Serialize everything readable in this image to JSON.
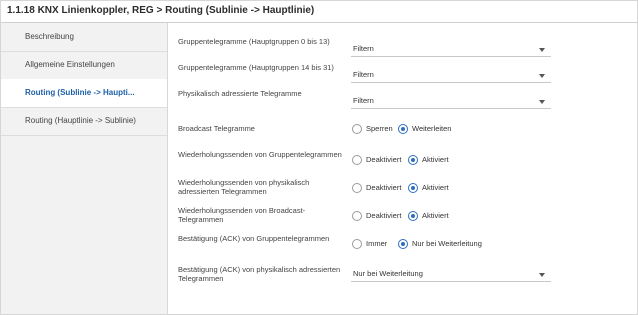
{
  "window": {
    "title": "1.1.18 KNX Linienkoppler, REG > Routing (Sublinie -> Hauptlinie)"
  },
  "sidebar": {
    "items": [
      {
        "label": "Beschreibung",
        "active": false
      },
      {
        "label": "Allgemeine Einstellungen",
        "active": false
      },
      {
        "label": "Routing (Sublinie -> Haupti...",
        "active": true
      },
      {
        "label": "Routing (Hauptlinie -> Sublinie)",
        "active": false
      }
    ]
  },
  "params": [
    {
      "label": "Gruppentelegramme (Hauptgruppen 0 bis 13)",
      "type": "select",
      "value": "Filtern"
    },
    {
      "label": "Gruppentelegramme (Hauptgruppen 14 bis 31)",
      "type": "select",
      "value": "Filtern"
    },
    {
      "label": "Physikalisch adressierte Telegramme",
      "type": "select",
      "value": "Filtern"
    },
    {
      "label": "Broadcast Telegramme",
      "type": "radio",
      "options": [
        "Sperren",
        "Weiterleiten"
      ],
      "selected": "Weiterleiten"
    },
    {
      "label": "Wiederholungssenden von Gruppentelegrammen",
      "type": "radio",
      "options": [
        "Deaktiviert",
        "Aktiviert"
      ],
      "selected": "Aktiviert"
    },
    {
      "label": "Wiederholungssenden von physikalisch adressierten Telegrammen",
      "type": "radio",
      "options": [
        "Deaktiviert",
        "Aktiviert"
      ],
      "selected": "Aktiviert"
    },
    {
      "label": "Wiederholungssenden von Broadcast-Telegrammen",
      "type": "radio",
      "options": [
        "Deaktiviert",
        "Aktiviert"
      ],
      "selected": "Aktiviert"
    },
    {
      "label": "Bestätigung (ACK) von Gruppentelegrammen",
      "type": "radio",
      "options": [
        "Immer",
        "Nur bei Weiterleitung"
      ],
      "selected": "Nur bei Weiterleitung"
    },
    {
      "label": "Bestätigung (ACK) von physikalisch adressierten Telegrammen",
      "type": "select",
      "value": "Nur bei Weiterleitung"
    }
  ],
  "colors": {
    "accent": "#2e6fbf",
    "active_nav_text": "#1f5fa8"
  }
}
